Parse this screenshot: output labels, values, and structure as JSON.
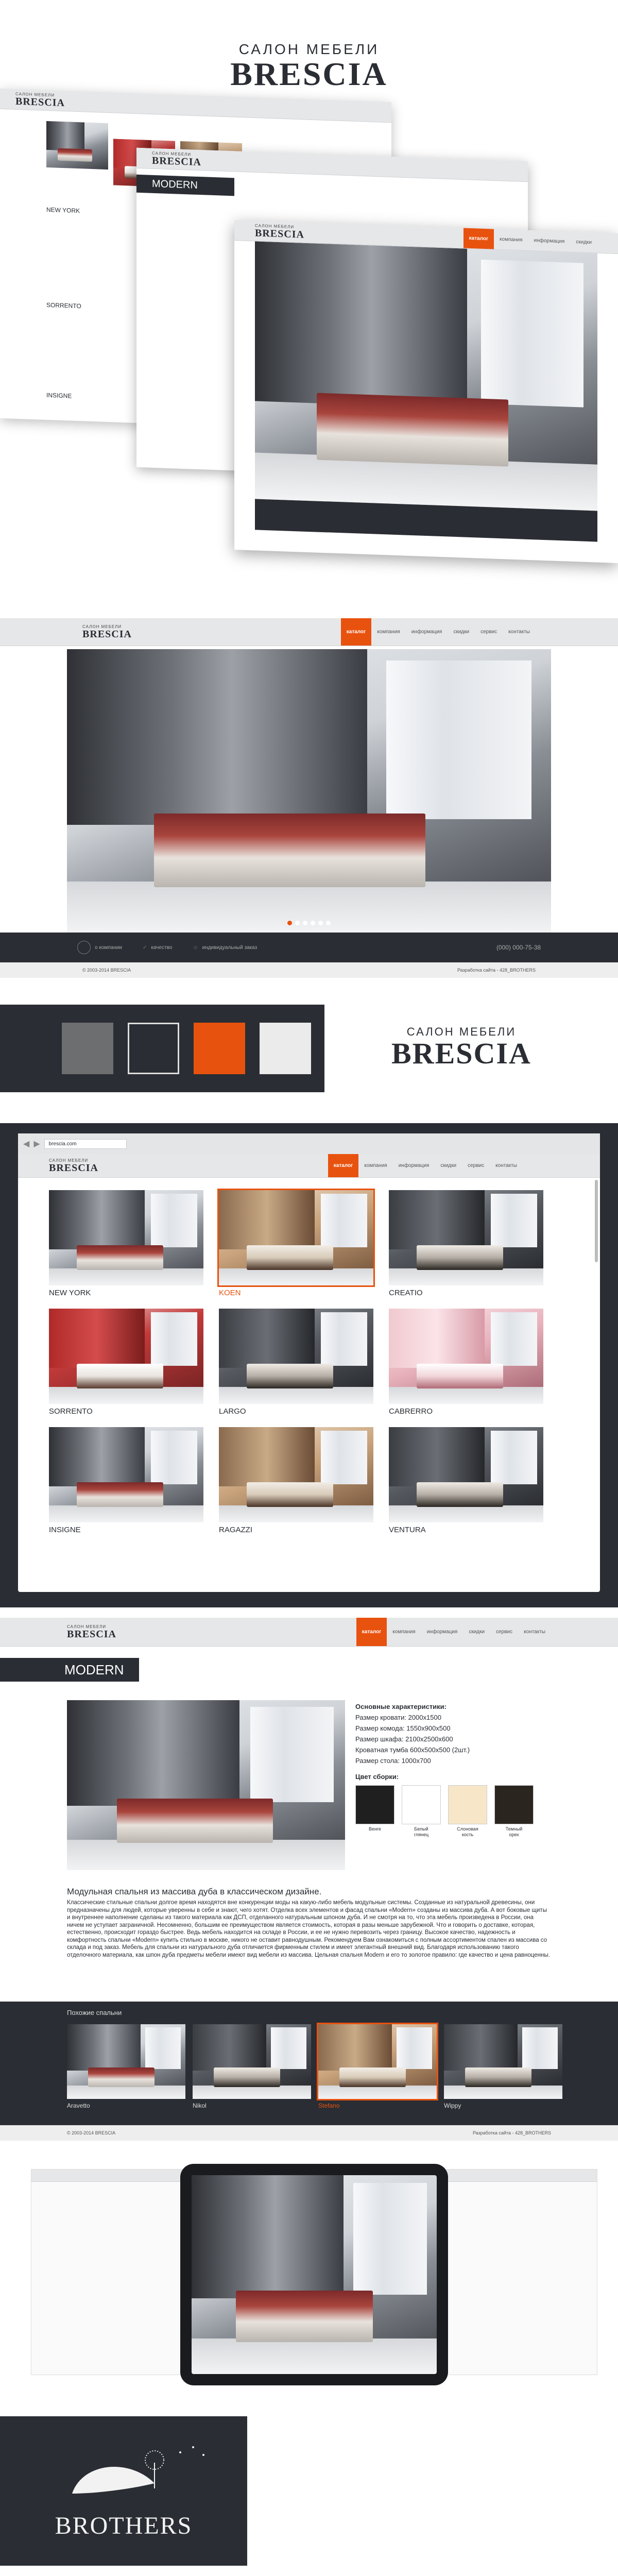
{
  "brand": {
    "pre": "САЛОН МЕБЕЛИ",
    "name": "BRESCIA",
    "small_pre": "САЛОН МЕБЕЛИ"
  },
  "nav": [
    "каталог",
    "компания",
    "информация",
    "скидки",
    "сервис",
    "контакты"
  ],
  "hero": {
    "dots": 6,
    "actions": [
      {
        "icon": "headset-icon",
        "label": "о компании"
      },
      {
        "icon": "check-icon",
        "label": "качество"
      },
      {
        "icon": "user-icon",
        "label": "индивидуальный заказ"
      }
    ],
    "phone": "(000) 000-75-38"
  },
  "footer": {
    "left": "© 2003-2014  BRESCIA",
    "right": "Разработка сайта - 428_BROTHERS"
  },
  "palette": [
    "#6d6e70",
    "#2a2d33",
    "#e8520f",
    "#ebebeb"
  ],
  "browser": {
    "url": "brescia.com"
  },
  "catalog": [
    {
      "name": "NEW YORK",
      "theme": ""
    },
    {
      "name": "KOEN",
      "theme": "warm"
    },
    {
      "name": "CREATIO",
      "theme": "dark"
    },
    {
      "name": "SORRENTO",
      "theme": "red"
    },
    {
      "name": "LARGO",
      "theme": "dark"
    },
    {
      "name": "CABRERRO",
      "theme": "pink"
    },
    {
      "name": "INSIGNE",
      "theme": ""
    },
    {
      "name": "RAGAZZI",
      "theme": "warm"
    },
    {
      "name": "VENTURA",
      "theme": "dark"
    }
  ],
  "product": {
    "title": "MODERN",
    "specs_title": "Основные характеристики:",
    "specs": [
      "Размер кровати: 2000x1500",
      "Размер комода: 1550x900x500",
      "Размер шкафа: 2100x2500x600",
      "Кроватная тумба 600x500x500 (2шт.)",
      "Размер стола: 1000x700"
    ],
    "color_title": "Цвет сборки:",
    "colors": [
      {
        "label": "Венге",
        "hex": "#1f1f20"
      },
      {
        "label": "Белый\nглянец",
        "hex": "#ffffff"
      },
      {
        "label": "Слоновая\nкость",
        "hex": "#f7e6c8"
      },
      {
        "label": "Темный\nорех",
        "hex": "#2b2520"
      }
    ],
    "heading": "Модульная спальня из массива дуба в классическом дизайне.",
    "text": "Классические стильные спальни долгое время находятся вне конкуренции моды на какую-либо мебель модульные системы. Созданные из натуральной древесины, они предназначены для людей, которые уверенны в себе и знают, чего хотят. Отделка всех элементов и фасад спальни «Modern» созданы из массива дуба. А вот боковые щиты и внутреннее наполнение сделаны из такого материала как ДСП, отделанного натуральным шпоном дуба. И не смотря на то, что эта мебель произведена в России, она ничем не уступает заграничной. Несомненно, большим ее преимуществом является стоимость, которая в разы меньше зарубежной. Что и говорить о доставке, которая, естественно, происходит гораздо быстрее. Ведь мебель находится на складе в России, и ее не нужно перевозить через границу. Высокое качество, надежность и комфортность спальни «Modern» купить стильно в москве, никого не оставит равнодушным. Рекомендуем Вам ознакомиться с полным ассортиментом спален из массива со склада и под заказ. Мебель для спальни из натурального дуба отличается фирменным стилем и имеет элегантный внешний вид. Благодаря использованию такого отделочного материала, как шпон дуба предметы мебели имеют вид мебели из массива. Цельная спальня Modern и его то золотое правило: где качество и цена равноценны.",
    "similar_title": "Похожие спальни",
    "similar": [
      {
        "name": "Aravetto",
        "theme": ""
      },
      {
        "name": "Nikol",
        "theme": "dark"
      },
      {
        "name": "Stefano",
        "theme": "warm"
      },
      {
        "name": "Wippy",
        "theme": "dark"
      }
    ]
  },
  "brothers": "BROTHERS"
}
